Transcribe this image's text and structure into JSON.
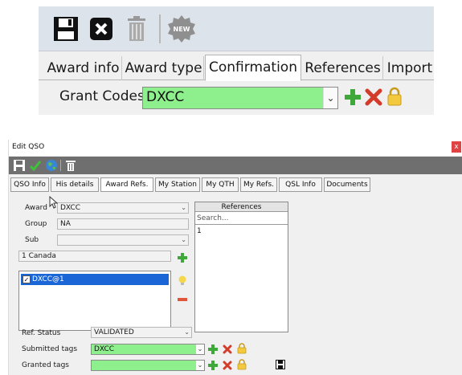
{
  "top": {
    "toolbar": [
      {
        "name": "save-icon"
      },
      {
        "name": "close-icon"
      },
      {
        "name": "trash-icon"
      },
      {
        "name": "new-badge-icon",
        "label": "NEW"
      }
    ],
    "tabs": [
      {
        "label": "Award info",
        "active": false
      },
      {
        "label": "Award type",
        "active": false
      },
      {
        "label": "Confirmation",
        "active": true
      },
      {
        "label": "References",
        "active": false
      },
      {
        "label": "Import",
        "active": false
      }
    ],
    "grant_codes": {
      "label": "Grant Codes",
      "value": "DXCC"
    }
  },
  "window": {
    "title": "Edit QSO",
    "close": "x",
    "tabs": [
      {
        "label": "QSO Info",
        "active": false
      },
      {
        "label": "His details",
        "active": false
      },
      {
        "label": "Award Refs.",
        "active": true
      },
      {
        "label": "My Station",
        "active": false
      },
      {
        "label": "My QTH",
        "active": false
      },
      {
        "label": "My Refs.",
        "active": false
      },
      {
        "label": "QSL Info",
        "active": false
      },
      {
        "label": "Documents",
        "active": false
      }
    ],
    "award": {
      "label": "Award",
      "value": "DXCC"
    },
    "group": {
      "label": "Group",
      "value": "NA"
    },
    "sub": {
      "label": "Sub",
      "value": ""
    },
    "entity": {
      "value": "1 Canada"
    },
    "references": {
      "header": "References",
      "search_placeholder": "Search...",
      "items": [
        "1"
      ]
    },
    "tags": {
      "items": [
        {
          "label": "DXCC@1",
          "checked": true
        }
      ]
    },
    "ref_status": {
      "label": "Ref. Status",
      "value": "VALIDATED"
    },
    "submitted_tags": {
      "label": "Submitted tags",
      "value": "DXCC"
    },
    "granted_tags": {
      "label": "Granted tags",
      "value": ""
    }
  },
  "colors": {
    "green_field": "#8ef08c",
    "selection": "#1b66d6",
    "close_red": "#e04343",
    "toolbar_gray": "#6f6f6f"
  }
}
